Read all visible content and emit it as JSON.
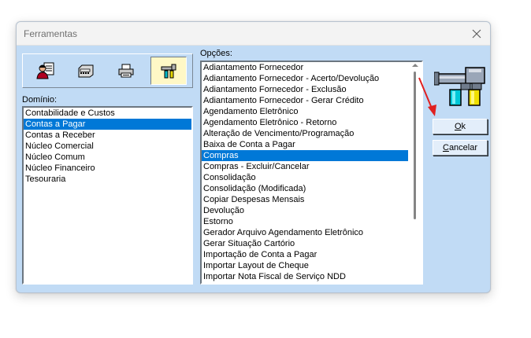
{
  "window": {
    "title": "Ferramentas"
  },
  "toolbar": {
    "buttons": [
      {
        "icon": "user-document-icon",
        "active": false
      },
      {
        "icon": "calculator-icon",
        "active": false
      },
      {
        "icon": "printer-icon",
        "active": false
      },
      {
        "icon": "tools-icon",
        "active": true
      }
    ]
  },
  "dominio": {
    "label": "Domínio:",
    "items": [
      "Contabilidade e Custos",
      "Contas a Pagar",
      "Contas a Receber",
      "Núcleo Comercial",
      "Núcleo Comum",
      "Núcleo Financeiro",
      "Tesouraria"
    ],
    "selected_index": 1
  },
  "opcoes": {
    "label": "Opções:",
    "items": [
      "Adiantamento Fornecedor",
      "Adiantamento Fornecedor - Acerto/Devolução",
      "Adiantamento Fornecedor - Exclusão",
      "Adiantamento Fornecedor - Gerar Crédito",
      "Agendamento Eletrônico",
      "Agendamento Eletrônico - Retorno",
      "Alteração de Vencimento/Programação",
      "Baixa de Conta a Pagar",
      "Compras",
      "Compras - Excluir/Cancelar",
      "Consolidação",
      "Consolidação (Modificada)",
      "Copiar Despesas Mensais",
      "Devolução",
      "Estorno",
      "Gerador Arquivo Agendamento Eletrônico",
      "Gerar Situação Cartório",
      "Importação de Conta a Pagar",
      "Importar Layout de Cheque",
      "Importar Nota Fiscal de Serviço NDD"
    ],
    "selected_index": 8
  },
  "buttons": {
    "ok_mnemonic": "O",
    "ok_rest": "k",
    "cancel_mnemonic": "C",
    "cancel_rest": "ancelar"
  },
  "colors": {
    "accent": "#0078d7",
    "dialog_bg": "#c1dbf5",
    "annotation_arrow": "#e02020"
  }
}
